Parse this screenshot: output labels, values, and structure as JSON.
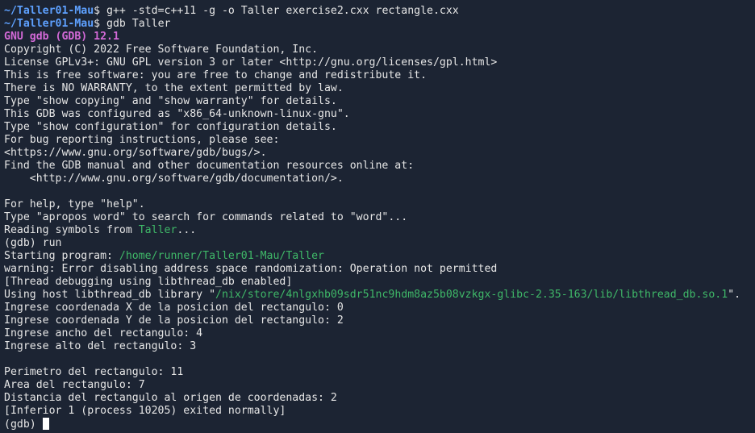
{
  "prompt": {
    "path": "~/Taller01-Mau",
    "symbol": "$ "
  },
  "commands": {
    "compile": "g++ -std=c++11 -g -o Taller exercise2.cxx rectangle.cxx",
    "gdb": "gdb Taller"
  },
  "banner": {
    "version": "GNU gdb (GDB) 12.1",
    "lines": [
      "Copyright (C) 2022 Free Software Foundation, Inc.",
      "License GPLv3+: GNU GPL version 3 or later <http://gnu.org/licenses/gpl.html>",
      "This is free software: you are free to change and redistribute it.",
      "There is NO WARRANTY, to the extent permitted by law.",
      "Type \"show copying\" and \"show warranty\" for details.",
      "This GDB was configured as \"x86_64-unknown-linux-gnu\".",
      "Type \"show configuration\" for configuration details.",
      "For bug reporting instructions, please see:",
      "<https://www.gnu.org/software/gdb/bugs/>.",
      "Find the GDB manual and other documentation resources online at:",
      "    <http://www.gnu.org/software/gdb/documentation/>."
    ],
    "help_lines": [
      "For help, type \"help\".",
      "Type \"apropos word\" to search for commands related to \"word\"..."
    ]
  },
  "reading": {
    "prefix": "Reading symbols from ",
    "file": "Taller",
    "suffix": "..."
  },
  "gdb_prompt": "(gdb) ",
  "run_cmd": "run",
  "starting": {
    "prefix": "Starting program: ",
    "path": "/home/runner/Taller01-Mau/Taller"
  },
  "warning": "warning: Error disabling address space randomization: Operation not permitted",
  "thread_debug": "[Thread debugging using libthread_db enabled]",
  "host_lib": {
    "prefix": "Using host libthread_db library \"",
    "path": "/nix/store/4nlgxhb09sdr51nc9hdm8az5b08vzkgx-glibc-2.35-163/lib/libthread_db.so.1",
    "suffix": "\"."
  },
  "program_input": [
    "Ingrese coordenada X de la posicion del rectangulo: 0",
    "Ingrese coordenada Y de la posicion del rectangulo: 2",
    "Ingrese ancho del rectangulo: 4",
    "Ingrese alto del rectangulo: 3"
  ],
  "program_output": [
    "Perimetro del rectangulo: 11",
    "Area del rectangulo: 7",
    "Distancia del rectangulo al origen de coordenadas: 2"
  ],
  "exit_msg": "[Inferior 1 (process 10205) exited normally]",
  "colors": {
    "background": "#1c2433",
    "prompt_path": "#5ea1ff",
    "gdb_version": "#d46ad8",
    "path_highlight": "#3fb868"
  }
}
